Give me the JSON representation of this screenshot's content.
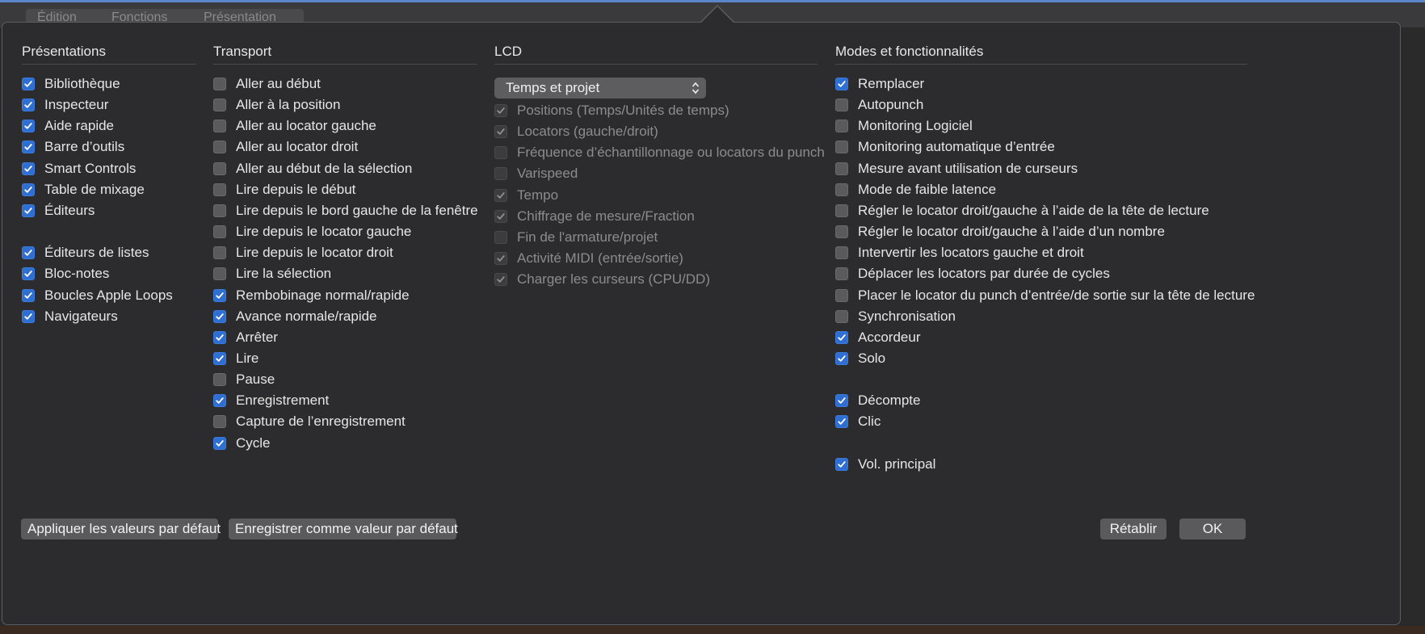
{
  "background_app": {
    "menu": [
      "Édition",
      "Fonctions",
      "Présentation"
    ]
  },
  "columns": {
    "presentations": {
      "title": "Présentations",
      "items": [
        {
          "label": "Bibliothèque",
          "checked": true
        },
        {
          "label": "Inspecteur",
          "checked": true
        },
        {
          "label": "Aide rapide",
          "checked": true
        },
        {
          "label": "Barre d’outils",
          "checked": true
        },
        {
          "label": "Smart Controls",
          "checked": true
        },
        {
          "label": "Table de mixage",
          "checked": true
        },
        {
          "label": "Éditeurs",
          "checked": true
        },
        {
          "label": "Éditeurs de listes",
          "checked": true
        },
        {
          "label": "Bloc-notes",
          "checked": true
        },
        {
          "label": "Boucles Apple Loops",
          "checked": true
        },
        {
          "label": "Navigateurs",
          "checked": true
        }
      ]
    },
    "transport": {
      "title": "Transport",
      "items": [
        {
          "label": "Aller au début",
          "checked": false
        },
        {
          "label": "Aller à la position",
          "checked": false
        },
        {
          "label": "Aller au locator gauche",
          "checked": false
        },
        {
          "label": "Aller au locator droit",
          "checked": false
        },
        {
          "label": "Aller au début de la sélection",
          "checked": false
        },
        {
          "label": "Lire depuis le début",
          "checked": false
        },
        {
          "label": "Lire depuis le bord gauche de la fenêtre",
          "checked": false
        },
        {
          "label": "Lire depuis le locator gauche",
          "checked": false
        },
        {
          "label": "Lire depuis le locator droit",
          "checked": false
        },
        {
          "label": "Lire la sélection",
          "checked": false
        },
        {
          "label": "Rembobinage normal/rapide",
          "checked": true
        },
        {
          "label": "Avance normale/rapide",
          "checked": true
        },
        {
          "label": "Arrêter",
          "checked": true
        },
        {
          "label": "Lire",
          "checked": true
        },
        {
          "label": "Pause",
          "checked": false
        },
        {
          "label": "Enregistrement",
          "checked": true
        },
        {
          "label": "Capture de l’enregistrement",
          "checked": false
        },
        {
          "label": "Cycle",
          "checked": true
        }
      ]
    },
    "lcd": {
      "title": "LCD",
      "select_value": "Temps et projet",
      "items": [
        {
          "label": "Positions (Temps/Unités de temps)",
          "checked": true
        },
        {
          "label": "Locators (gauche/droit)",
          "checked": true
        },
        {
          "label": "Fréquence d’échantillonnage ou locators du punch",
          "checked": false
        },
        {
          "label": "Varispeed",
          "checked": false
        },
        {
          "label": "Tempo",
          "checked": true
        },
        {
          "label": "Chiffrage de mesure/Fraction",
          "checked": true
        },
        {
          "label": "Fin de l'armature/projet",
          "checked": false
        },
        {
          "label": "Activité MIDI (entrée/sortie)",
          "checked": true
        },
        {
          "label": "Charger les curseurs (CPU/DD)",
          "checked": true
        }
      ]
    },
    "modes": {
      "title": "Modes et fonctionnalités",
      "items": [
        {
          "label": "Remplacer",
          "checked": true
        },
        {
          "label": "Autopunch",
          "checked": false
        },
        {
          "label": "Monitoring Logiciel",
          "checked": false
        },
        {
          "label": "Monitoring automatique d’entrée",
          "checked": false
        },
        {
          "label": "Mesure avant utilisation de curseurs",
          "checked": false
        },
        {
          "label": "Mode de faible latence",
          "checked": false
        },
        {
          "label": "Régler le locator droit/gauche à l’aide de la tête de lecture",
          "checked": false
        },
        {
          "label": "Régler le locator droit/gauche à l’aide d’un nombre",
          "checked": false
        },
        {
          "label": "Intervertir les locators gauche et droit",
          "checked": false
        },
        {
          "label": "Déplacer les locators par durée de cycles",
          "checked": false
        },
        {
          "label": "Placer le locator du punch d’entrée/de sortie sur la tête de lecture",
          "checked": false
        },
        {
          "label": "Synchronisation",
          "checked": false
        },
        {
          "label": "Accordeur",
          "checked": true
        },
        {
          "label": "Solo",
          "checked": true
        },
        {
          "label": "Décompte",
          "checked": true
        },
        {
          "label": "Clic",
          "checked": true
        },
        {
          "label": "Vol. principal",
          "checked": true
        }
      ]
    }
  },
  "buttons": {
    "apply_defaults": "Appliquer les valeurs par défaut",
    "save_default": "Enregistrer comme valeur par défaut",
    "revert": "Rétablir",
    "ok": "OK"
  },
  "colors": {
    "accent": "#2f6fd1",
    "panel": "#2c2c2e"
  }
}
